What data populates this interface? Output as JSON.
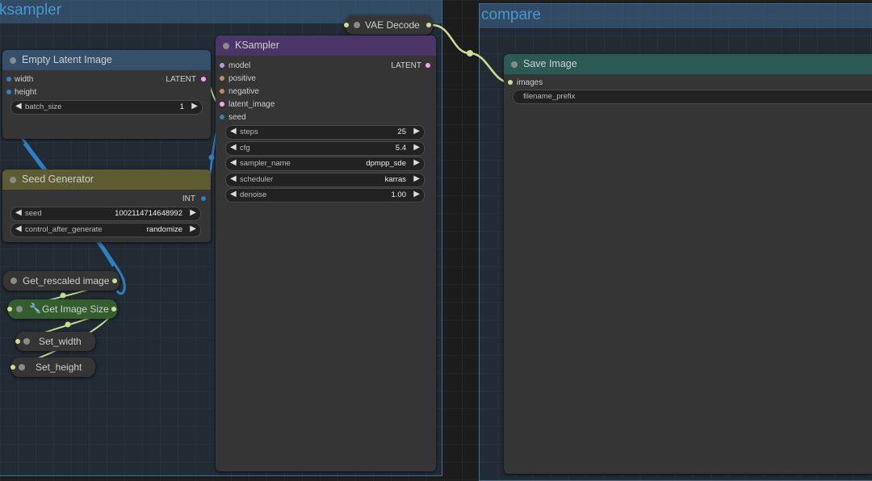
{
  "groups": {
    "ksampler": "ksampler",
    "compare": "compare"
  },
  "nodes": {
    "vae_decode": {
      "title": "VAE Decode"
    },
    "empty_latent": {
      "title": "Empty Latent Image",
      "inputs": [
        "width",
        "height"
      ],
      "output": "LATENT",
      "batch_size": {
        "label": "batch_size",
        "value": "1"
      }
    },
    "ksampler": {
      "title": "KSampler",
      "inputs": [
        "model",
        "positive",
        "negative",
        "latent_image",
        "seed"
      ],
      "output": "LATENT",
      "widgets": [
        {
          "label": "steps",
          "value": "25"
        },
        {
          "label": "cfg",
          "value": "5.4"
        },
        {
          "label": "sampler_name",
          "value": "dpmpp_sde"
        },
        {
          "label": "scheduler",
          "value": "karras"
        },
        {
          "label": "denoise",
          "value": "1.00"
        }
      ]
    },
    "seed_generator": {
      "title": "Seed Generator",
      "output": "INT",
      "seed": {
        "label": "seed",
        "value": "1002114714648992"
      },
      "control": {
        "label": "control_after_generate",
        "value": "randomize"
      }
    },
    "get_rescaled": {
      "title": "Get_rescaled image"
    },
    "get_image_size": {
      "title": "Get Image Size"
    },
    "set_width": {
      "title": "Set_width"
    },
    "set_height": {
      "title": "Set_height"
    },
    "save_image": {
      "title": "Save Image",
      "input": "images",
      "filename_prefix": {
        "label": "filename_prefix",
        "value": ""
      }
    }
  },
  "colors": {
    "link_image": "#c9e08d",
    "link_int": "#2f7fc4",
    "latent_slot": "#ff9cf9",
    "model_slot": "#b39ddb"
  },
  "icons": {
    "widget_arrow": "triangle-arrow-icon",
    "wrench": "wrench-icon"
  }
}
